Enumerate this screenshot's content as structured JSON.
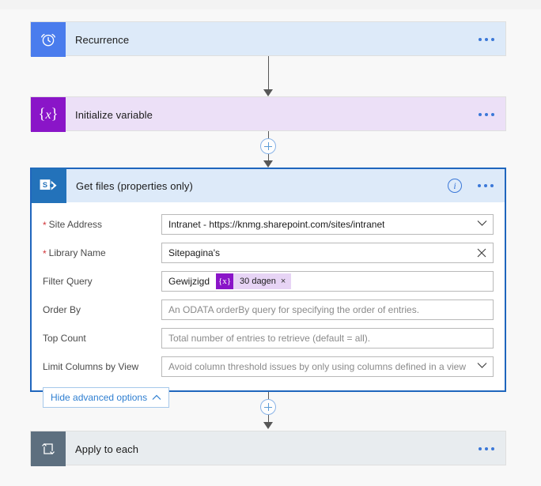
{
  "flow": {
    "steps": [
      {
        "id": "recurrence",
        "title": "Recurrence",
        "icon": "alarm-clock-icon",
        "menu": "more-commands"
      },
      {
        "id": "initialize-variable",
        "title": "Initialize variable",
        "icon": "variable-braces-icon",
        "menu": "more-commands"
      },
      {
        "id": "get-files",
        "title": "Get files (properties only)",
        "icon": "sharepoint-icon",
        "menu": "more-commands",
        "info": "information-icon"
      },
      {
        "id": "apply-to-each",
        "title": "Apply to each",
        "icon": "loop-icon",
        "menu": "more-commands"
      }
    ],
    "insert_button_label": "+"
  },
  "get_files_form": {
    "fields": [
      {
        "label": "Site Address",
        "required": true,
        "value": "Intranet - https://knmg.sharepoint.com/sites/intranet",
        "placeholder": "",
        "control": "dropdown"
      },
      {
        "label": "Library Name",
        "required": true,
        "value": "Sitepagina's",
        "placeholder": "",
        "control": "clearable"
      },
      {
        "label": "Filter Query",
        "required": false,
        "value": "Gewijzigd",
        "placeholder": "",
        "control": "token",
        "token": {
          "icon": "{x}",
          "label": "30 dagen",
          "remove": "×"
        }
      },
      {
        "label": "Order By",
        "required": false,
        "value": "",
        "placeholder": "An ODATA orderBy query for specifying the order of entries.",
        "control": "text"
      },
      {
        "label": "Top Count",
        "required": false,
        "value": "",
        "placeholder": "Total number of entries to retrieve (default = all).",
        "control": "text"
      },
      {
        "label": "Limit Columns by View",
        "required": false,
        "value": "",
        "placeholder": "Avoid column threshold issues by only using columns defined in a view",
        "control": "dropdown"
      }
    ],
    "advanced_options_button": "Hide advanced options"
  },
  "colors": {
    "recurrence_accent": "#4a7ced",
    "recurrence_body": "#ddeaf9",
    "variable_accent": "#8a15c8",
    "variable_body": "#ece0f7",
    "sharepoint_accent": "#2372ba",
    "selected_border": "#1f66bd",
    "loop_accent": "#5d6f7f",
    "loop_body": "#e8ecef",
    "required_asterisk": "#d13438",
    "link_blue": "#2f7fd1"
  }
}
